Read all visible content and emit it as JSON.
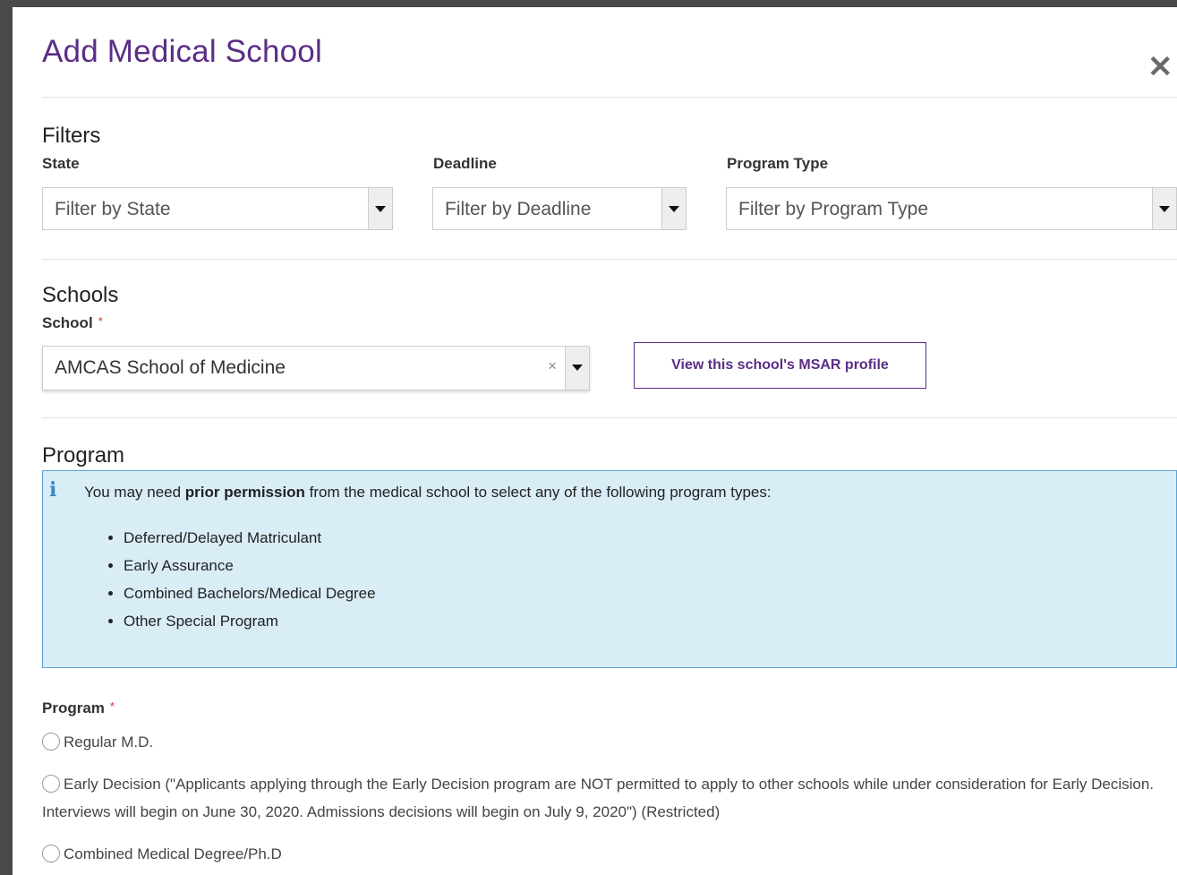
{
  "modal": {
    "title": "Add Medical School"
  },
  "filters": {
    "heading": "Filters",
    "state": {
      "label": "State",
      "placeholder": "Filter by State"
    },
    "deadline": {
      "label": "Deadline",
      "placeholder": "Filter by Deadline"
    },
    "program_type": {
      "label": "Program Type",
      "placeholder": "Filter by Program Type"
    }
  },
  "schools": {
    "heading": "Schools",
    "school_label": "School",
    "required_mark": "*",
    "selected_value": "AMCAS School of Medicine",
    "clear_glyph": "×",
    "profile_button": "View this school's MSAR profile"
  },
  "program_info": {
    "heading": "Program",
    "icon": "info-icon",
    "intro_before": "You may need ",
    "intro_bold": "prior permission",
    "intro_after": " from the medical school to select any of the following program types:",
    "items": [
      "Deferred/Delayed Matriculant",
      "Early Assurance",
      "Combined Bachelors/Medical Degree",
      "Other Special Program"
    ]
  },
  "program_select": {
    "label": "Program",
    "required_mark": "*",
    "options": [
      "Regular M.D.",
      "Early Decision (\"Applicants applying through the Early Decision program are NOT permitted to apply to other schools while under consideration for Early Decision. Interviews will begin on June 30, 2020. Admissions decisions will begin on July 9, 2020\") (Restricted)",
      "Combined Medical Degree/Ph.D"
    ]
  },
  "colors": {
    "title": "#5b2d86",
    "info_bg": "#d9edf7",
    "info_border": "#5aa3d8",
    "required": "#c0392b"
  }
}
